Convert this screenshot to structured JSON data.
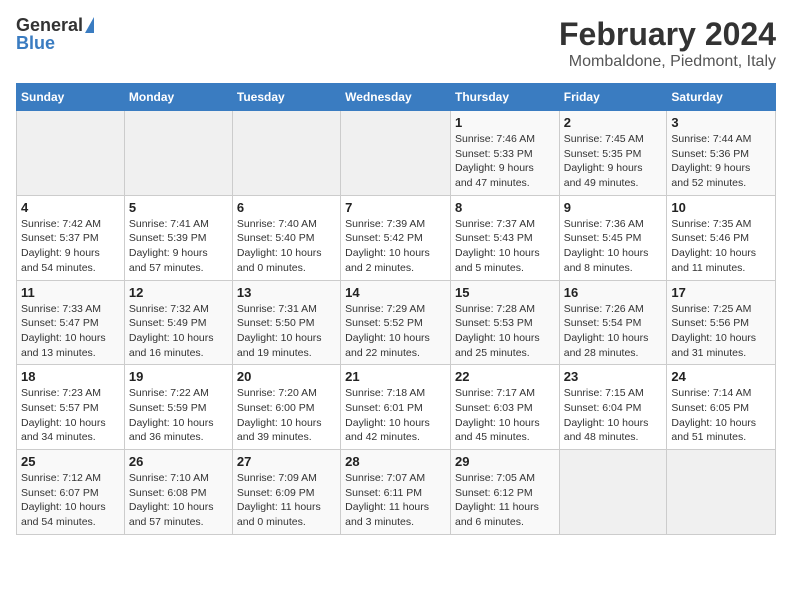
{
  "header": {
    "logo_general": "General",
    "logo_blue": "Blue",
    "title": "February 2024",
    "subtitle": "Mombaldone, Piedmont, Italy"
  },
  "columns": [
    "Sunday",
    "Monday",
    "Tuesday",
    "Wednesday",
    "Thursday",
    "Friday",
    "Saturday"
  ],
  "weeks": [
    [
      {
        "day": "",
        "info": ""
      },
      {
        "day": "",
        "info": ""
      },
      {
        "day": "",
        "info": ""
      },
      {
        "day": "",
        "info": ""
      },
      {
        "day": "1",
        "info": "Sunrise: 7:46 AM\nSunset: 5:33 PM\nDaylight: 9 hours\nand 47 minutes."
      },
      {
        "day": "2",
        "info": "Sunrise: 7:45 AM\nSunset: 5:35 PM\nDaylight: 9 hours\nand 49 minutes."
      },
      {
        "day": "3",
        "info": "Sunrise: 7:44 AM\nSunset: 5:36 PM\nDaylight: 9 hours\nand 52 minutes."
      }
    ],
    [
      {
        "day": "4",
        "info": "Sunrise: 7:42 AM\nSunset: 5:37 PM\nDaylight: 9 hours\nand 54 minutes."
      },
      {
        "day": "5",
        "info": "Sunrise: 7:41 AM\nSunset: 5:39 PM\nDaylight: 9 hours\nand 57 minutes."
      },
      {
        "day": "6",
        "info": "Sunrise: 7:40 AM\nSunset: 5:40 PM\nDaylight: 10 hours\nand 0 minutes."
      },
      {
        "day": "7",
        "info": "Sunrise: 7:39 AM\nSunset: 5:42 PM\nDaylight: 10 hours\nand 2 minutes."
      },
      {
        "day": "8",
        "info": "Sunrise: 7:37 AM\nSunset: 5:43 PM\nDaylight: 10 hours\nand 5 minutes."
      },
      {
        "day": "9",
        "info": "Sunrise: 7:36 AM\nSunset: 5:45 PM\nDaylight: 10 hours\nand 8 minutes."
      },
      {
        "day": "10",
        "info": "Sunrise: 7:35 AM\nSunset: 5:46 PM\nDaylight: 10 hours\nand 11 minutes."
      }
    ],
    [
      {
        "day": "11",
        "info": "Sunrise: 7:33 AM\nSunset: 5:47 PM\nDaylight: 10 hours\nand 13 minutes."
      },
      {
        "day": "12",
        "info": "Sunrise: 7:32 AM\nSunset: 5:49 PM\nDaylight: 10 hours\nand 16 minutes."
      },
      {
        "day": "13",
        "info": "Sunrise: 7:31 AM\nSunset: 5:50 PM\nDaylight: 10 hours\nand 19 minutes."
      },
      {
        "day": "14",
        "info": "Sunrise: 7:29 AM\nSunset: 5:52 PM\nDaylight: 10 hours\nand 22 minutes."
      },
      {
        "day": "15",
        "info": "Sunrise: 7:28 AM\nSunset: 5:53 PM\nDaylight: 10 hours\nand 25 minutes."
      },
      {
        "day": "16",
        "info": "Sunrise: 7:26 AM\nSunset: 5:54 PM\nDaylight: 10 hours\nand 28 minutes."
      },
      {
        "day": "17",
        "info": "Sunrise: 7:25 AM\nSunset: 5:56 PM\nDaylight: 10 hours\nand 31 minutes."
      }
    ],
    [
      {
        "day": "18",
        "info": "Sunrise: 7:23 AM\nSunset: 5:57 PM\nDaylight: 10 hours\nand 34 minutes."
      },
      {
        "day": "19",
        "info": "Sunrise: 7:22 AM\nSunset: 5:59 PM\nDaylight: 10 hours\nand 36 minutes."
      },
      {
        "day": "20",
        "info": "Sunrise: 7:20 AM\nSunset: 6:00 PM\nDaylight: 10 hours\nand 39 minutes."
      },
      {
        "day": "21",
        "info": "Sunrise: 7:18 AM\nSunset: 6:01 PM\nDaylight: 10 hours\nand 42 minutes."
      },
      {
        "day": "22",
        "info": "Sunrise: 7:17 AM\nSunset: 6:03 PM\nDaylight: 10 hours\nand 45 minutes."
      },
      {
        "day": "23",
        "info": "Sunrise: 7:15 AM\nSunset: 6:04 PM\nDaylight: 10 hours\nand 48 minutes."
      },
      {
        "day": "24",
        "info": "Sunrise: 7:14 AM\nSunset: 6:05 PM\nDaylight: 10 hours\nand 51 minutes."
      }
    ],
    [
      {
        "day": "25",
        "info": "Sunrise: 7:12 AM\nSunset: 6:07 PM\nDaylight: 10 hours\nand 54 minutes."
      },
      {
        "day": "26",
        "info": "Sunrise: 7:10 AM\nSunset: 6:08 PM\nDaylight: 10 hours\nand 57 minutes."
      },
      {
        "day": "27",
        "info": "Sunrise: 7:09 AM\nSunset: 6:09 PM\nDaylight: 11 hours\nand 0 minutes."
      },
      {
        "day": "28",
        "info": "Sunrise: 7:07 AM\nSunset: 6:11 PM\nDaylight: 11 hours\nand 3 minutes."
      },
      {
        "day": "29",
        "info": "Sunrise: 7:05 AM\nSunset: 6:12 PM\nDaylight: 11 hours\nand 6 minutes."
      },
      {
        "day": "",
        "info": ""
      },
      {
        "day": "",
        "info": ""
      }
    ]
  ]
}
